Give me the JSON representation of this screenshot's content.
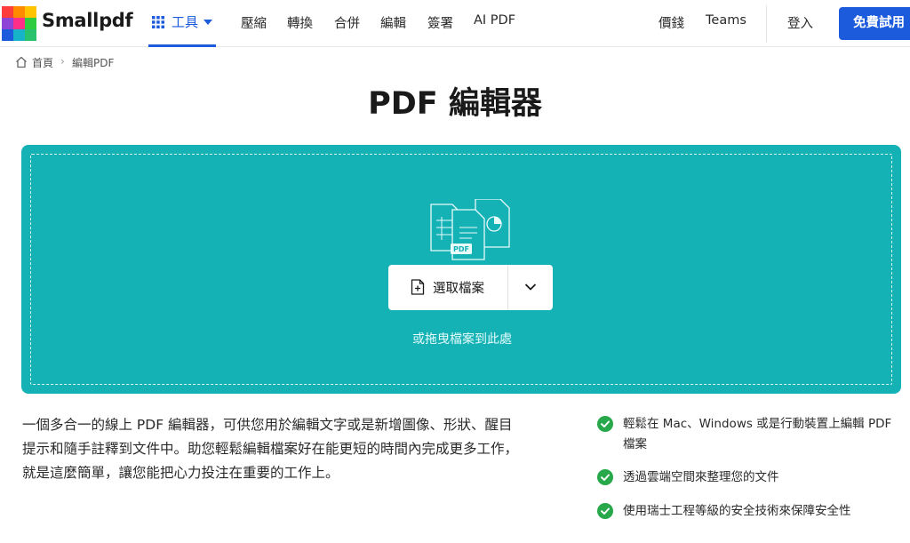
{
  "colors": {
    "brand_blue": "#1c5bdc",
    "teal": "#14b1b5",
    "check_green": "#27a84a"
  },
  "header": {
    "logo_text": "Smallpdf",
    "tools_label": "工具",
    "nav": [
      "壓縮",
      "轉換",
      "合併",
      "編輯",
      "簽署",
      "AI PDF"
    ],
    "pricing": "價錢",
    "teams": "Teams",
    "login": "登入",
    "signup": "免費試用"
  },
  "breadcrumb": {
    "home": "首頁",
    "separator": "›",
    "current": "編輯PDF"
  },
  "page_title": "PDF 編輯器",
  "dropzone": {
    "choose_label": "選取檔案",
    "drop_hint": "或拖曳檔案到此處",
    "illustration_badge": "PDF"
  },
  "description": "一個多合一的線上 PDF 編輯器，可供您用於編輯文字或是新增圖像、形狀、醒目提示和隨手註釋到文件中。助您輕鬆編輯檔案好在能更短的時間內完成更多工作，就是這麼簡單，讓您能把心力投注在重要的工作上。",
  "features": [
    "輕鬆在 Mac、Windows 或是行動裝置上編輯 PDF 檔案",
    "透過雲端空間來整理您的文件",
    "使用瑞士工程等級的安全技術來保障安全性"
  ]
}
